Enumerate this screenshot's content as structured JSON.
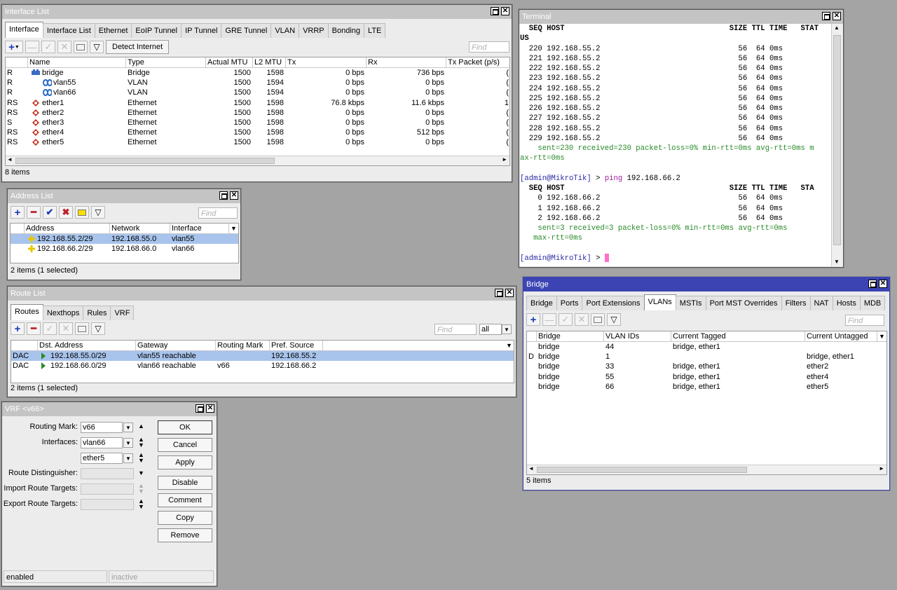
{
  "interface_list": {
    "title": "Interface List",
    "tabs": [
      "Interface",
      "Interface List",
      "Ethernet",
      "EoIP Tunnel",
      "IP Tunnel",
      "GRE Tunnel",
      "VLAN",
      "VRRP",
      "Bonding",
      "LTE"
    ],
    "detect_internet": "Detect Internet",
    "find_placeholder": "Find",
    "columns": [
      "",
      "Name",
      "Type",
      "Actual MTU",
      "L2 MTU",
      "Tx",
      "Rx",
      "Tx Packet (p/s)"
    ],
    "rows": [
      {
        "flag": "R",
        "name": "bridge",
        "type": "Bridge",
        "mtu": "1500",
        "l2mtu": "1598",
        "tx": "0 bps",
        "rx": "736 bps",
        "txp": "(",
        "icon": "bridge-icon"
      },
      {
        "flag": "R",
        "name": "vlan55",
        "type": "VLAN",
        "mtu": "1500",
        "l2mtu": "1594",
        "tx": "0 bps",
        "rx": "0 bps",
        "txp": "(",
        "icon": "vlan-icon"
      },
      {
        "flag": "R",
        "name": "vlan66",
        "type": "VLAN",
        "mtu": "1500",
        "l2mtu": "1594",
        "tx": "0 bps",
        "rx": "0 bps",
        "txp": "(",
        "icon": "vlan-icon"
      },
      {
        "flag": "RS",
        "name": "ether1",
        "type": "Ethernet",
        "mtu": "1500",
        "l2mtu": "1598",
        "tx": "76.8 kbps",
        "rx": "11.6 kbps",
        "txp": "1",
        "icon": "ethernet-icon"
      },
      {
        "flag": "RS",
        "name": "ether2",
        "type": "Ethernet",
        "mtu": "1500",
        "l2mtu": "1598",
        "tx": "0 bps",
        "rx": "0 bps",
        "txp": "(",
        "icon": "ethernet-icon"
      },
      {
        "flag": "S",
        "name": "ether3",
        "type": "Ethernet",
        "mtu": "1500",
        "l2mtu": "1598",
        "tx": "0 bps",
        "rx": "0 bps",
        "txp": "(",
        "icon": "ethernet-icon"
      },
      {
        "flag": "RS",
        "name": "ether4",
        "type": "Ethernet",
        "mtu": "1500",
        "l2mtu": "1598",
        "tx": "0 bps",
        "rx": "512 bps",
        "txp": "(",
        "icon": "ethernet-icon"
      },
      {
        "flag": "RS",
        "name": "ether5",
        "type": "Ethernet",
        "mtu": "1500",
        "l2mtu": "1598",
        "tx": "0 bps",
        "rx": "0 bps",
        "txp": "(",
        "icon": "ethernet-icon"
      }
    ],
    "status": "8 items"
  },
  "address_list": {
    "title": "Address List",
    "find_placeholder": "Find",
    "columns": [
      "Address",
      "Network",
      "Interface"
    ],
    "rows": [
      {
        "address": "192.168.55.2/29",
        "network": "192.168.55.0",
        "interface": "vlan55",
        "selected": true
      },
      {
        "address": "192.168.66.2/29",
        "network": "192.168.66.0",
        "interface": "vlan66",
        "selected": false
      }
    ],
    "status": "2 items (1 selected)"
  },
  "route_list": {
    "title": "Route List",
    "tabs": [
      "Routes",
      "Nexthops",
      "Rules",
      "VRF"
    ],
    "find_placeholder": "Find",
    "filter_value": "all",
    "columns": [
      "",
      "Dst. Address",
      "Gateway",
      "Routing Mark",
      "Pref. Source"
    ],
    "rows": [
      {
        "flag": "DAC",
        "dst": "192.168.55.0/29",
        "gateway": "vlan55 reachable",
        "mark": "",
        "pref": "192.168.55.2",
        "selected": true
      },
      {
        "flag": "DAC",
        "dst": "192.168.66.0/29",
        "gateway": "vlan66 reachable",
        "mark": "v66",
        "pref": "192.168.66.2",
        "selected": false
      }
    ],
    "status": "2 items (1 selected)"
  },
  "vrf": {
    "title": "VRF <v66>",
    "labels": {
      "routing_mark": "Routing Mark:",
      "interfaces": "Interfaces:",
      "route_distinguisher": "Route Distinguisher:",
      "import_rt": "Import Route Targets:",
      "export_rt": "Export Route Targets:"
    },
    "values": {
      "routing_mark": "v66",
      "interface1": "vlan66",
      "interface2": "ether5"
    },
    "buttons": [
      "OK",
      "Cancel",
      "Apply",
      "Disable",
      "Comment",
      "Copy",
      "Remove"
    ],
    "status_left": "enabled",
    "status_right": "inactive"
  },
  "terminal": {
    "title": "Terminal",
    "header1": "  SEQ HOST                                     SIZE TTL TIME   STAT",
    "header1b": "US",
    "ping1": [
      "  220 192.168.55.2                               56  64 0ms",
      "  221 192.168.55.2                               56  64 0ms",
      "  222 192.168.55.2                               56  64 0ms",
      "  223 192.168.55.2                               56  64 0ms",
      "  224 192.168.55.2                               56  64 0ms",
      "  225 192.168.55.2                               56  64 0ms",
      "  226 192.168.55.2                               56  64 0ms",
      "  227 192.168.55.2                               56  64 0ms",
      "  228 192.168.55.2                               56  64 0ms",
      "  229 192.168.55.2                               56  64 0ms"
    ],
    "summary1a": "    sent=230 received=230 packet-loss=0% min-rtt=0ms avg-rtt=0ms m",
    "summary1b": "ax-rtt=0ms",
    "prompt_user": "admin",
    "prompt_host": "MikroTik",
    "command": "ping",
    "command_arg": "192.168.66.2",
    "header2": "  SEQ HOST                                     SIZE TTL TIME   STA",
    "ping2": [
      "    0 192.168.66.2                               56  64 0ms",
      "    1 192.168.66.2                               56  64 0ms",
      "    2 192.168.66.2                               56  64 0ms"
    ],
    "summary2a": "    sent=3 received=3 packet-loss=0% min-rtt=0ms avg-rtt=0ms",
    "summary2b": "   max-rtt=0ms"
  },
  "bridge": {
    "title": "Bridge",
    "tabs": [
      "Bridge",
      "Ports",
      "Port Extensions",
      "VLANs",
      "MSTIs",
      "Port MST Overrides",
      "Filters",
      "NAT",
      "Hosts",
      "MDB"
    ],
    "find_placeholder": "Find",
    "columns": [
      "",
      "Bridge",
      "VLAN IDs",
      "Current Tagged",
      "Current Untagged"
    ],
    "rows": [
      {
        "flag": "",
        "bridge": "bridge",
        "vlan": "44",
        "tagged": "bridge, ether1",
        "untagged": ""
      },
      {
        "flag": "D",
        "bridge": "bridge",
        "vlan": "1",
        "tagged": "",
        "untagged": "bridge, ether1"
      },
      {
        "flag": "",
        "bridge": "bridge",
        "vlan": "33",
        "tagged": "bridge, ether1",
        "untagged": "ether2"
      },
      {
        "flag": "",
        "bridge": "bridge",
        "vlan": "55",
        "tagged": "bridge, ether1",
        "untagged": "ether4"
      },
      {
        "flag": "",
        "bridge": "bridge",
        "vlan": "66",
        "tagged": "bridge, ether1",
        "untagged": "ether5"
      }
    ],
    "status": "5 items"
  },
  "colors": {
    "selection": "#a8c4ec",
    "active_title": "#3c44b4",
    "inactive_title": "#c4c4c4",
    "desktop": "#a4a4a4",
    "terminal_green": "#2a8a2a"
  }
}
